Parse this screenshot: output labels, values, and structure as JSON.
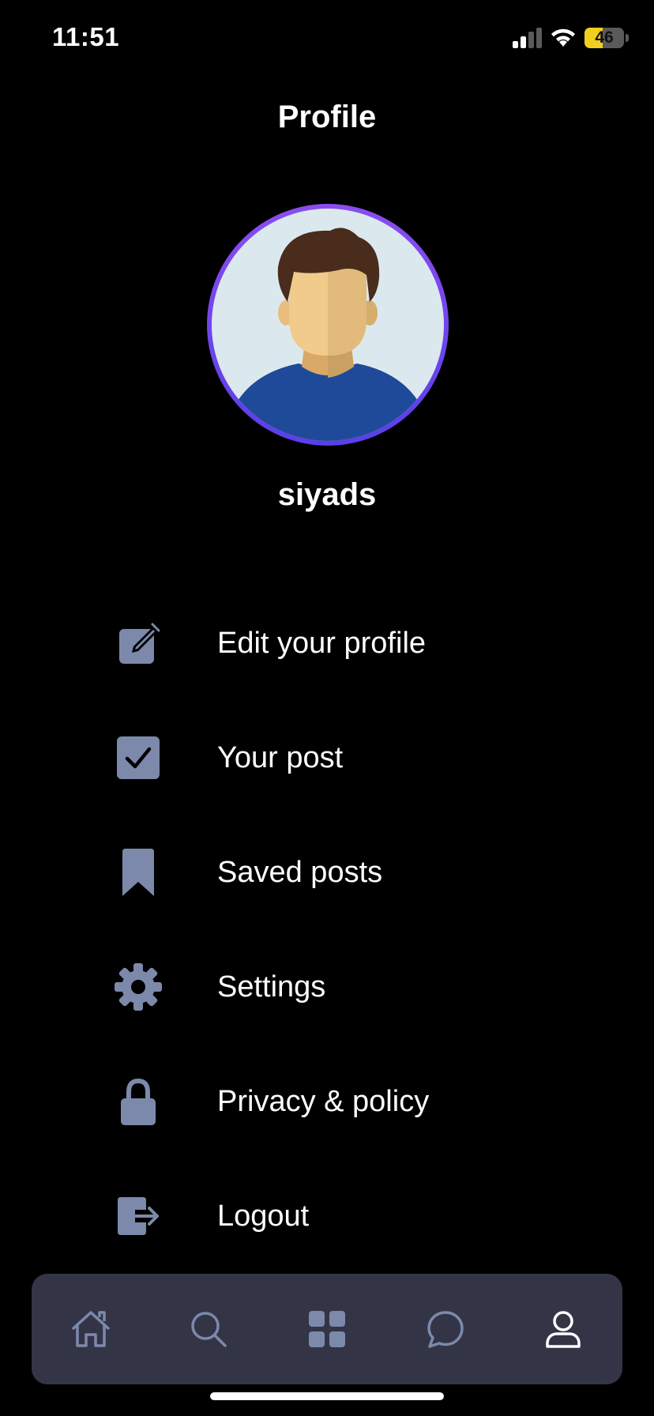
{
  "status_bar": {
    "time": "11:51",
    "battery_level": "46",
    "battery_fraction": 0.46
  },
  "header": {
    "title": "Profile"
  },
  "profile": {
    "username": "siyads"
  },
  "menu": {
    "items": [
      {
        "label": "Edit your profile",
        "icon": "edit-icon"
      },
      {
        "label": "Your post",
        "icon": "checkbox-icon"
      },
      {
        "label": "Saved posts",
        "icon": "bookmark-icon"
      },
      {
        "label": "Settings",
        "icon": "gear-icon"
      },
      {
        "label": "Privacy & policy",
        "icon": "lock-icon"
      },
      {
        "label": "Logout",
        "icon": "logout-icon"
      }
    ]
  },
  "tab_bar": {
    "tabs": [
      "home-icon",
      "search-icon",
      "grid-icon",
      "chat-icon",
      "profile-icon"
    ],
    "active": "profile-icon"
  },
  "colors": {
    "background": "#000000",
    "icon": "#7c89aa",
    "tab_bar": "#333547",
    "avatar_ring": "#6a40ee",
    "battery": "#f2cf1d"
  }
}
